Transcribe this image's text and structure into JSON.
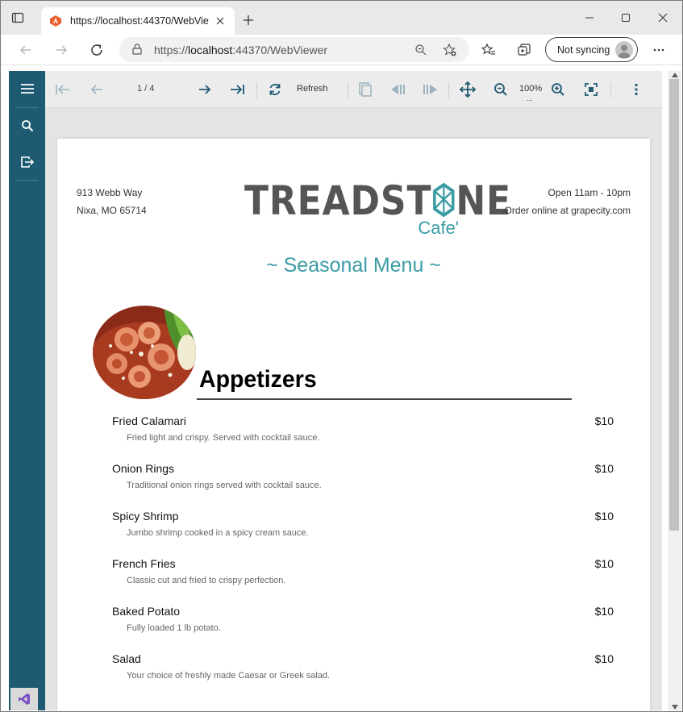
{
  "browser": {
    "tab_title": "https://localhost:44370/WebViewer",
    "address_host": "localhost",
    "address_prefix": "https://",
    "address_suffix": ":44370/WebViewer",
    "sync_label": "Not syncing"
  },
  "toolbar": {
    "page_counter": "1 / 4",
    "refresh_label": "Refresh",
    "zoom_level": "100%",
    "zoom_dots": "..."
  },
  "report": {
    "address_line1": "913 Webb Way",
    "address_line2": "Nixa, MO 65714",
    "hours_line1": "Open 11am - 10pm",
    "hours_line2": "Order online at grapecity.com",
    "logo_left": "TREADST",
    "logo_right": "NE",
    "logo_sub": "Cafe'",
    "seasonal_title": "~ Seasonal Menu ~",
    "section_title": "Appetizers",
    "items": [
      {
        "name": "Fried Calamari",
        "price": "$10",
        "desc": "Fried light and crispy. Served with cocktail sauce."
      },
      {
        "name": "Onion Rings",
        "price": "$10",
        "desc": "Traditional onion rings served with cocktail sauce."
      },
      {
        "name": "Spicy Shrimp",
        "price": "$10",
        "desc": "Jumbo shrimp cooked in a spicy cream sauce."
      },
      {
        "name": "French Fries",
        "price": "$10",
        "desc": "Classic cut and fried to crispy perfection."
      },
      {
        "name": "Baked Potato",
        "price": "$10",
        "desc": "Fully loaded 1 lb potato."
      },
      {
        "name": "Salad",
        "price": "$10",
        "desc": "Your choice of freshly made Caesar or Greek salad."
      }
    ]
  },
  "colors": {
    "sidebar": "#1f5a73",
    "accent": "#3b9ca4"
  }
}
